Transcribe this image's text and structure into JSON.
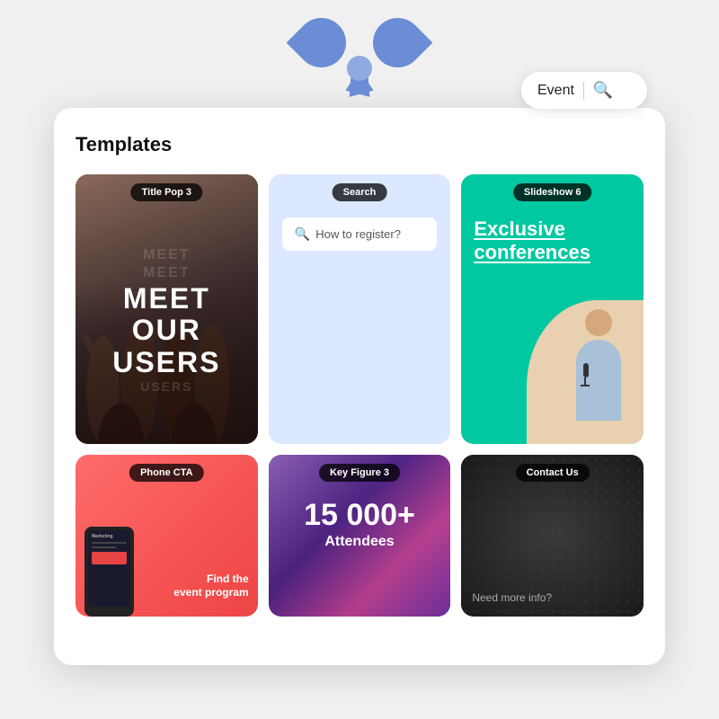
{
  "page": {
    "title": "Templates"
  },
  "search_bar": {
    "label": "Event",
    "icon": "🔍"
  },
  "cards": [
    {
      "id": "title-pop",
      "badge": "Title Pop 3",
      "ghost_lines": [
        "MEET",
        "MEET",
        "MEET"
      ],
      "main_text": [
        "MEET",
        "OUR",
        "USERS"
      ],
      "echo_lines": [
        "USERS",
        "USERS"
      ]
    },
    {
      "id": "search",
      "badge": "Search",
      "search_placeholder": "How to register?"
    },
    {
      "id": "slideshow",
      "badge": "Slideshow 6",
      "title_line1": "Exclusive",
      "title_line2": "conferences"
    },
    {
      "id": "phone-cta",
      "badge": "Phone CTA",
      "marketing_label": "Marketing",
      "cta_line1": "Find the",
      "cta_line2": "event program"
    },
    {
      "id": "key-figure",
      "badge": "Key Figure 3",
      "number": "15 000+",
      "label": "Attendees"
    },
    {
      "id": "contact",
      "badge": "Contact Us",
      "subtitle": "Need more info?"
    }
  ]
}
